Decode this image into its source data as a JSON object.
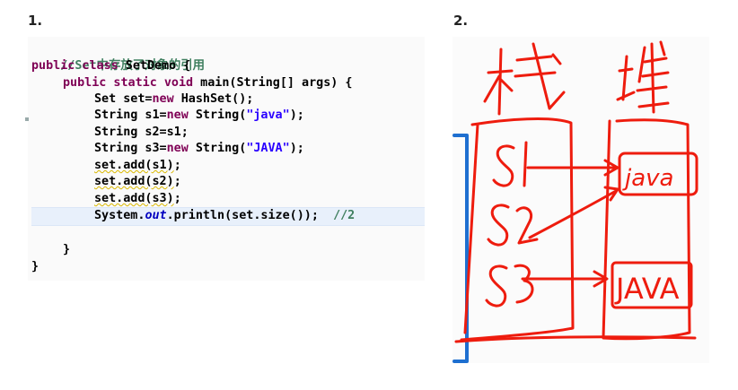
{
  "labels": {
    "first": "1.",
    "second": "2."
  },
  "code": {
    "comment": "//Set中存放了对象的引用",
    "class_decl": {
      "kw": "public class",
      "rest": " SetDemo {"
    },
    "main_decl": {
      "kw": "public static void",
      "rest": " main(String[] args) {"
    },
    "line_set": {
      "pre": "Set set=",
      "kw": "new",
      "post": " HashSet();"
    },
    "line_s1": {
      "pre": "String s1=",
      "kw": "new",
      "mid": " String(",
      "str": "\"java\"",
      "post": ");"
    },
    "line_s2": "String s2=s1;",
    "line_s3": {
      "pre": "String s3=",
      "kw": "new",
      "mid": " String(",
      "str": "\"JAVA\"",
      "post": ");"
    },
    "add1": {
      "a": "set.add(s1)",
      "b": ";"
    },
    "add2": {
      "a": "set.add(s2)",
      "b": ";"
    },
    "add3": {
      "a": "set.add(s3)",
      "b": ";"
    },
    "println": {
      "pre": "System.",
      "field": "out",
      "post": ".println(set.size());",
      "comment": "//2"
    },
    "close_method": "}",
    "close_class": "}"
  },
  "drawing": {
    "stack_label": "栈",
    "heap_label": "堆",
    "vars": [
      "S1",
      "S2",
      "S3"
    ],
    "heap_objects": [
      "java",
      "JAVA"
    ],
    "ink_color": "#ee1c0e",
    "bracket_color": "#1e6fd0"
  }
}
